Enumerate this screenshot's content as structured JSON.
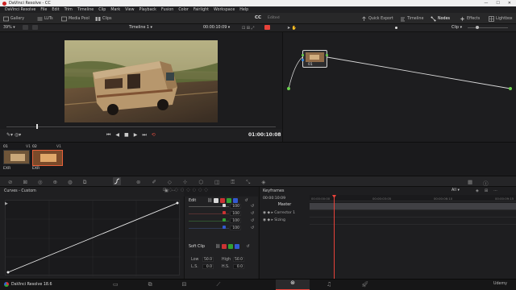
{
  "window": {
    "title": "DaVinci Resolve - CC"
  },
  "menu": [
    "DaVinci Resolve",
    "File",
    "Edit",
    "Trim",
    "Timeline",
    "Clip",
    "Mark",
    "View",
    "Playback",
    "Fusion",
    "Color",
    "Fairlight",
    "Workspace",
    "Help"
  ],
  "toolbar": {
    "gallery": "Gallery",
    "luts": "LUTs",
    "media_pool": "Media Pool",
    "clips": "Clips",
    "project": "CC",
    "edited": "Edited",
    "quick_export": "Quick Export",
    "timeline": "Timeline",
    "nodes": "Nodes",
    "effects": "Effects",
    "lightbox": "Lightbox"
  },
  "viewerbar": {
    "zoom": "39%",
    "timeline_name": "Timeline 1",
    "timecode": "00:00:10:09",
    "clip_mode": "Clip"
  },
  "viewer": {
    "timecode": "01:00:10:08"
  },
  "node": {
    "label": "01"
  },
  "clips": [
    {
      "num": "01",
      "track": "V1",
      "format": "EXR"
    },
    {
      "num": "02",
      "track": "V1",
      "format": "EXR"
    }
  ],
  "tooltip": "Curves",
  "curves": {
    "title": "Curves - Custom"
  },
  "edit": {
    "title": "Edit",
    "values": [
      "100",
      "100",
      "100",
      "100"
    ],
    "soft_clip_title": "Soft Clip",
    "low_label": "Low",
    "low": "50.0",
    "high_label": "High",
    "high": "50.0",
    "ls_label": "L.S.",
    "ls": "0.0",
    "hs_label": "H.S.",
    "hs": "0.0"
  },
  "keyframes": {
    "title": "Keyframes",
    "filter": "All",
    "timecode": "00:00:10:09",
    "ticks": [
      "00:00:00:00",
      "00:00:03:05",
      "00:00:06:10",
      "00:00:09:15"
    ],
    "tracks": [
      "Master",
      "Corrector 1",
      "Sizing"
    ]
  },
  "status": {
    "app": "DaVinci Resolve 18.6"
  },
  "watermark": "Udemy",
  "colors": {
    "accent": "#e8423a",
    "play": "#d24a3d",
    "node_line": "#d8d8d8",
    "green_dot": "#6ad14c"
  }
}
